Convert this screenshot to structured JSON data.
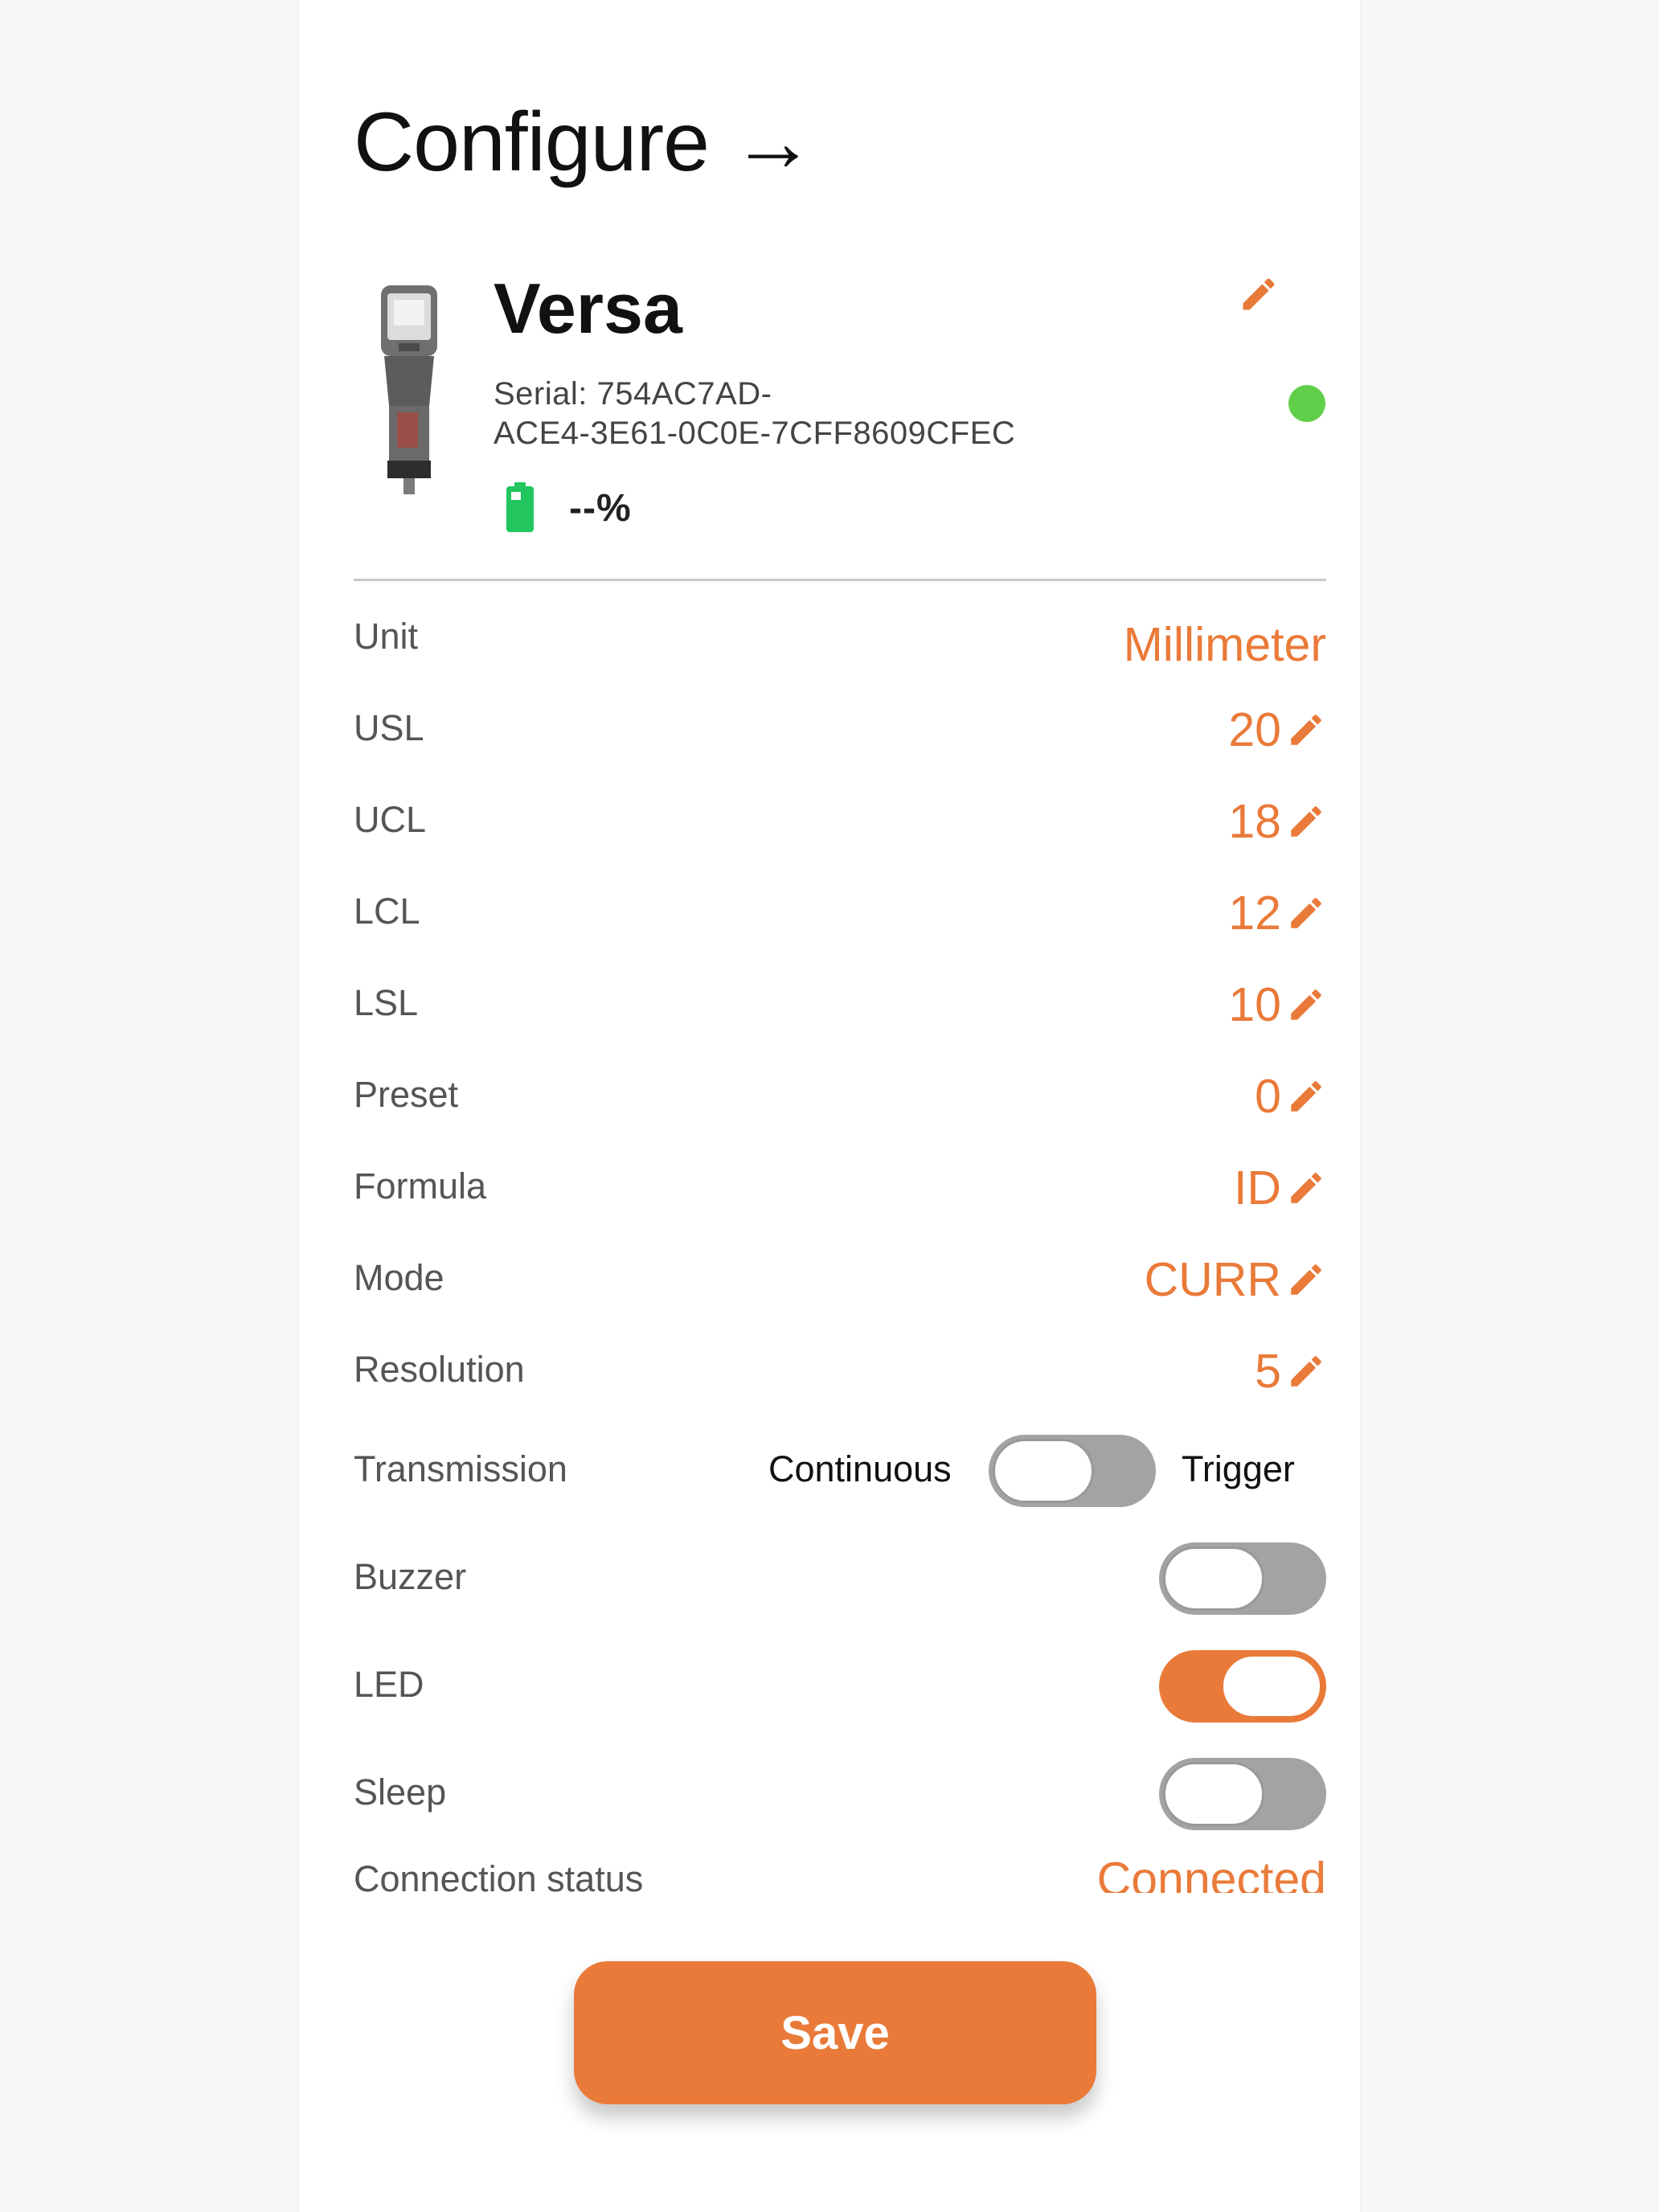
{
  "header": {
    "title": "Configure",
    "arrow": "→"
  },
  "device": {
    "name": "Versa",
    "serial_line1": "Serial: 754AC7AD-",
    "serial_line2": "ACE4-3E61-0C0E-7CFF8609CFEC",
    "battery": "--%",
    "status_color": "#62cf4b"
  },
  "settings": {
    "unit": {
      "label": "Unit",
      "value": "Millimeter"
    },
    "usl": {
      "label": "USL",
      "value": "20"
    },
    "ucl": {
      "label": "UCL",
      "value": "18"
    },
    "lcl": {
      "label": "LCL",
      "value": "12"
    },
    "lsl": {
      "label": "LSL",
      "value": "10"
    },
    "preset": {
      "label": "Preset",
      "value": "0"
    },
    "formula": {
      "label": "Formula",
      "value": "ID"
    },
    "mode": {
      "label": "Mode",
      "value": "CURR"
    },
    "resolution": {
      "label": "Resolution",
      "value": "5"
    },
    "transmission": {
      "label": "Transmission",
      "left_option": "Continuous",
      "right_option": "Trigger",
      "state": "Continuous"
    },
    "buzzer": {
      "label": "Buzzer",
      "on": false
    },
    "led": {
      "label": "LED",
      "on": true
    },
    "sleep": {
      "label": "Sleep",
      "on": false
    },
    "connection_status": {
      "label": "Connection status",
      "value": "Connected"
    }
  },
  "actions": {
    "save_label": "Save"
  },
  "colors": {
    "accent": "#ea7a39",
    "toggle_off": "#a3a3a3",
    "battery": "#22c55e"
  },
  "icons": {
    "edit": "pencil-icon",
    "battery": "battery-icon",
    "status": "status-dot"
  }
}
